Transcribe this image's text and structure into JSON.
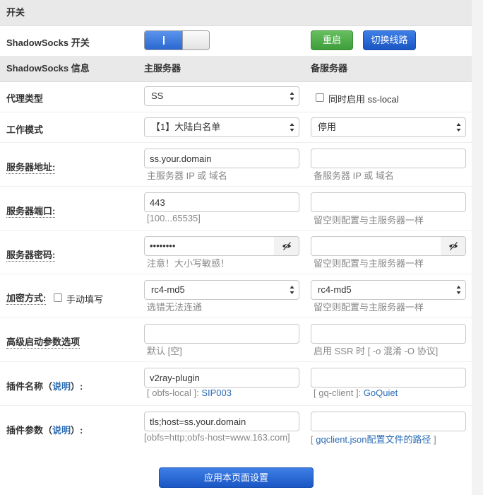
{
  "section": {
    "title": "开关"
  },
  "switch_row": {
    "label": "ShadowSocks 开关",
    "toggle_on": true,
    "restart_label": "重启",
    "switch_line_label": "切换线路"
  },
  "info_header": {
    "col1": "ShadowSocks 信息",
    "col2": "主服务器",
    "col3": "备服务器"
  },
  "proxy_type": {
    "label": "代理类型",
    "main_value": "SS",
    "ss_local_label": "同时启用 ss-local",
    "ss_local_checked": false
  },
  "work_mode": {
    "label": "工作模式",
    "main_value": "【1】大陆白名单",
    "backup_value": "停用"
  },
  "server_addr": {
    "label": "服务器地址:",
    "main_value": "ss.your.domain",
    "main_hint": "主服务器 IP 或 域名",
    "backup_value": "",
    "backup_hint": "备服务器 IP 或 域名"
  },
  "server_port": {
    "label": "服务器端口:",
    "main_value": "443",
    "main_hint": "[100...65535]",
    "backup_value": "",
    "backup_hint": "留空则配置与主服务器一样"
  },
  "server_pwd": {
    "label": "服务器密码:",
    "main_value": "••••••••",
    "main_hint": "注意！大小写敏感！",
    "backup_value": "",
    "backup_hint": "留空则配置与主服务器一样"
  },
  "encrypt": {
    "label": "加密方式:",
    "manual_label": "手动填写",
    "manual_checked": false,
    "main_value": "rc4-md5",
    "main_hint": "选错无法连通",
    "backup_value": "rc4-md5",
    "backup_hint": "留空则配置与主服务器一样"
  },
  "adv_params": {
    "label": "高级启动参数选项",
    "main_value": "",
    "main_hint": "默认 [空]",
    "backup_value": "",
    "backup_hint": "启用 SSR 时 [ -o 混淆 -O 协议]"
  },
  "plugin_name": {
    "label_prefix": "插件名称（",
    "label_link": "说明",
    "label_suffix": "）:",
    "main_value": "v2ray-plugin",
    "main_hint_prefix": "[ obfs-local ]: ",
    "main_hint_link": "SIP003",
    "backup_value": "",
    "backup_hint_prefix": "[ gq-client ]: ",
    "backup_hint_link": "GoQuiet"
  },
  "plugin_params": {
    "label_prefix": "插件参数（",
    "label_link": "说明",
    "label_suffix": "）:",
    "main_value": "tls;host=ss.your.domain",
    "main_hint": "[obfs=http;obfs-host=www.163.com]",
    "backup_value": "",
    "backup_hint_prefix": "[ ",
    "backup_hint_link": "gqclient.json配置文件的路径",
    "backup_hint_suffix": " ]"
  },
  "apply_button": {
    "label": "应用本页面设置"
  },
  "colors": {
    "header_bg": "#e9e9e9",
    "green": "#4aa644",
    "blue": "#2560cf",
    "link": "#2a6cb5"
  }
}
